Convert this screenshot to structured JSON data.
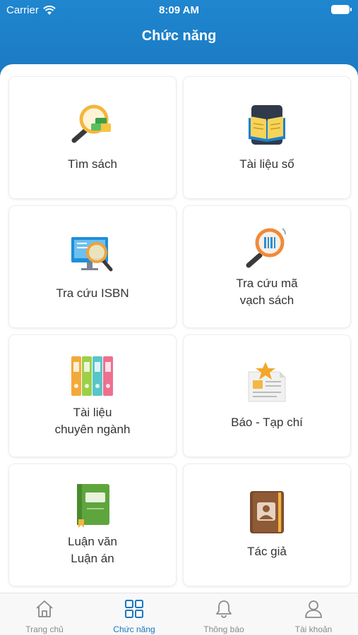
{
  "status_bar": {
    "carrier": "Carrier",
    "time": "8:09 AM"
  },
  "header": {
    "title": "Chức năng"
  },
  "functions": [
    {
      "label": "Tìm sách",
      "icon": "search-books-icon"
    },
    {
      "label": "Tài liệu số",
      "icon": "digital-book-icon"
    },
    {
      "label": "Tra cứu ISBN",
      "icon": "isbn-monitor-icon"
    },
    {
      "label": "Tra cứu mã\nvạch sách",
      "icon": "barcode-search-icon"
    },
    {
      "label": "Tài liệu\nchuyên ngành",
      "icon": "binders-icon"
    },
    {
      "label": "Báo - Tạp chí",
      "icon": "newspaper-icon"
    },
    {
      "label": "Luận văn\nLuận án",
      "icon": "thesis-book-icon"
    },
    {
      "label": "Tác giả",
      "icon": "author-contact-icon"
    }
  ],
  "tabbar": {
    "items": [
      {
        "label": "Trang chủ",
        "icon": "home-icon"
      },
      {
        "label": "Chức năng",
        "icon": "grid-icon",
        "active": true
      },
      {
        "label": "Thông báo",
        "icon": "bell-icon"
      },
      {
        "label": "Tài khoản",
        "icon": "user-icon"
      }
    ]
  },
  "colors": {
    "primary": "#1a78c0",
    "inactive_tab": "#8a8a8a"
  }
}
